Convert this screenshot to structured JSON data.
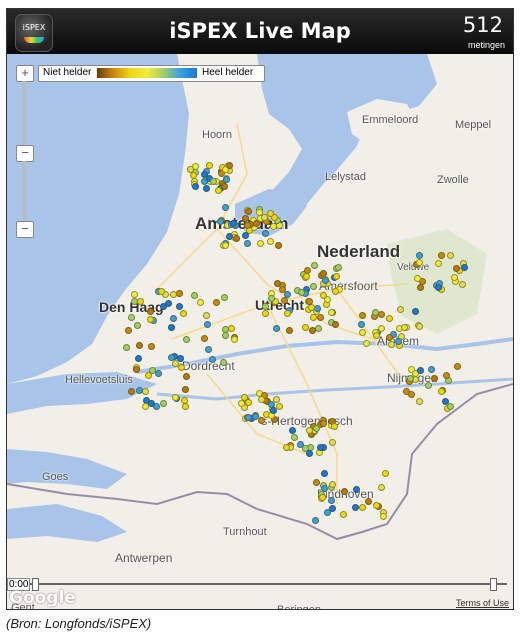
{
  "header": {
    "logo_text": "iSPEX",
    "title": "iSPEX Live Map",
    "count": "512",
    "count_label": "metingen"
  },
  "legend": {
    "left_label": "Niet helder",
    "right_label": "Heel helder"
  },
  "zoom": {
    "plus": "+",
    "minus": "−"
  },
  "timeline": {
    "label": "0:00"
  },
  "map": {
    "cities": [
      "Amsterdam",
      "Nederland",
      "Den Haag",
      "Utrecht",
      "Amersfoort",
      "Arnhem",
      "Nijmegen",
      "Dordrecht",
      "Hellevoetsluis",
      "'s-Hertogenbosch",
      "Eindhoven",
      "Turnhout",
      "Antwerpen",
      "Goes",
      "Gent",
      "Beringen",
      "Hoorn",
      "Lelystad",
      "Emmeloord",
      "Meppel",
      "Zwolle",
      "Veluwe"
    ],
    "attribution": "Google",
    "terms": "Terms of Use",
    "colors": {
      "water": "#a8c4e8",
      "land": "#f2efe9",
      "clear": "#1a78d8",
      "not_clear": "#6b3a00"
    }
  },
  "source": "(Bron: Longfonds/iSPEX)"
}
